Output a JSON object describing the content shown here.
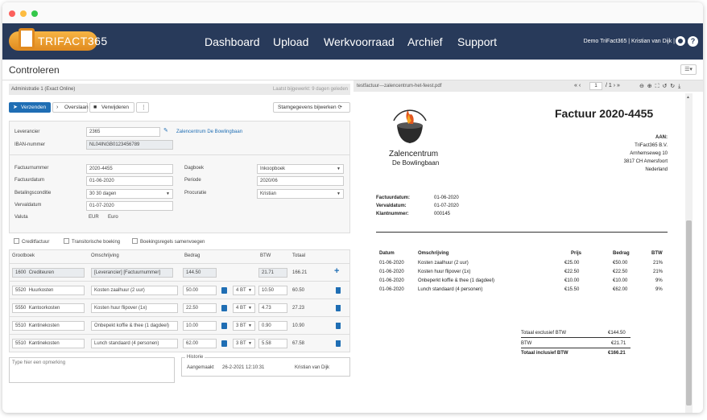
{
  "app": {
    "logo_text": "TRIFACT365"
  },
  "nav": {
    "items": [
      "Dashboard",
      "Upload",
      "Werkvoorraad",
      "Archief",
      "Support"
    ],
    "user": "Demo TriFact365  |  Kristian van Dijk  |"
  },
  "page": {
    "title": "Controleren"
  },
  "admin_bar": {
    "left": "Administratie 1 (Exact Online)",
    "right": "Laatst bijgewerkt: 9 dagen geleden"
  },
  "toolbar": {
    "send": "Verzenden",
    "skip": "Overslaan",
    "delete": "Verwijderen",
    "more": "⋮",
    "update": "Stamgegevens bijwerken"
  },
  "supplier": {
    "label_supplier": "Leverancier",
    "supplier_code": "2365",
    "supplier_name": "Zalencentrum De Bowlingbaan",
    "label_iban": "IBAN-nummer",
    "iban": "NL04INGB0123456789"
  },
  "invoice": {
    "label_number": "Factuurnummer",
    "number": "2020-4455",
    "label_date": "Factuurdatum",
    "date": "01-06-2020",
    "label_terms": "Betalingsconditie",
    "terms": "30 30 dagen",
    "label_due": "Vervaldatum",
    "due": "01-07-2020",
    "label_currency": "Valuta",
    "currency": "EUR",
    "currency_name": "Euro",
    "label_journal": "Dagboek",
    "journal": "Inkoopboek",
    "label_period": "Periode",
    "period": "2020/06",
    "label_proc": "Procuratie",
    "proc": "Kristian"
  },
  "checkboxes": [
    "Creditfactuur",
    "Transitorische boeking",
    "Boekingsregels samenvoegen"
  ],
  "lines": {
    "headers": [
      "Grootboek",
      "Omschrijving",
      "Bedrag",
      "BTW",
      "Totaal"
    ],
    "rows": [
      {
        "code": "1600",
        "ledger": "Crediteuren",
        "desc": "[Leverancier] [Factuurnummer]",
        "amount": "144.50",
        "vat_code": "",
        "vat": "21.71",
        "total": "166.21"
      },
      {
        "code": "5520",
        "ledger": "Huurkosten",
        "desc": "Kosten zaalhuur (2 uur)",
        "amount": "50.00",
        "vat_code": "4 BT",
        "vat": "10.50",
        "total": "60.50"
      },
      {
        "code": "5550",
        "ledger": "Kantoorkosten",
        "desc": "Kosten huur flipover (1x)",
        "amount": "22.50",
        "vat_code": "4 BT",
        "vat": "4.73",
        "total": "27.23"
      },
      {
        "code": "5510",
        "ledger": "Kantinekosten",
        "desc": "Onbepekt koffie & thee (1 dagdeel)",
        "amount": "10.00",
        "vat_code": "3 BT",
        "vat": "0.90",
        "total": "10.90"
      },
      {
        "code": "5510",
        "ledger": "Kantinekosten",
        "desc": "Lunch standaard (4 personen)",
        "amount": "62.00",
        "vat_code": "3 BT",
        "vat": "5.58",
        "total": "67.58"
      }
    ]
  },
  "remark": {
    "placeholder": "Type hier een opmerking"
  },
  "history": {
    "title": "Historie",
    "action": "Aangemaakt",
    "datetime": "26-2-2021 12:10:31",
    "user": "Kristian van Dijk"
  },
  "pdf": {
    "filename": "testfactuur---zalencentrum-het-feest.pdf",
    "nav_prev": "« ‹",
    "page": "1",
    "page_of": "/ 1 › »",
    "tools": "⊖ ⊕ ⛶ ↺ ↻ ⤓",
    "company_line1": "Zalencentrum",
    "company_line2": "De Bowlingbaan",
    "invoice_title": "Factuur 2020-4455",
    "to_label": "AAN:",
    "to_lines": [
      "TriFact365 B.V.",
      "Arnhemseweg 10",
      "3817 CH  Amersfoort",
      "Nederland"
    ],
    "meta": [
      {
        "label": "Factuurdatum:",
        "value": "01-06-2020"
      },
      {
        "label": "Vervaldatum:",
        "value": "01-07-2020"
      },
      {
        "label": "Klantnummer:",
        "value": "000145"
      }
    ],
    "table_headers": [
      "Datum",
      "Omschrijving",
      "Prijs",
      "Bedrag",
      "BTW"
    ],
    "table_rows": [
      {
        "date": "01-06-2020",
        "desc": "Kosten zaalhuur (2 uur)",
        "price": "€25.00",
        "amount": "€50.00",
        "vat": "21%"
      },
      {
        "date": "01-06-2020",
        "desc": "Kosten huur flipover (1x)",
        "price": "€22.50",
        "amount": "€22.50",
        "vat": "21%"
      },
      {
        "date": "01-06-2020",
        "desc": "Onbeperkt koffie & thee (1 dagdeel)",
        "price": "€10.00",
        "amount": "€10.00",
        "vat": "9%"
      },
      {
        "date": "01-06-2020",
        "desc": "Lunch standaard (4 personen)",
        "price": "€15.50",
        "amount": "€62.00",
        "vat": "9%"
      }
    ],
    "totals": [
      {
        "label": "Totaal exclusief BTW",
        "value": "€144.50"
      },
      {
        "label": "BTW",
        "value": "€21.71"
      },
      {
        "label": "Totaal inclusief BTW",
        "value": "€166.21"
      }
    ]
  }
}
